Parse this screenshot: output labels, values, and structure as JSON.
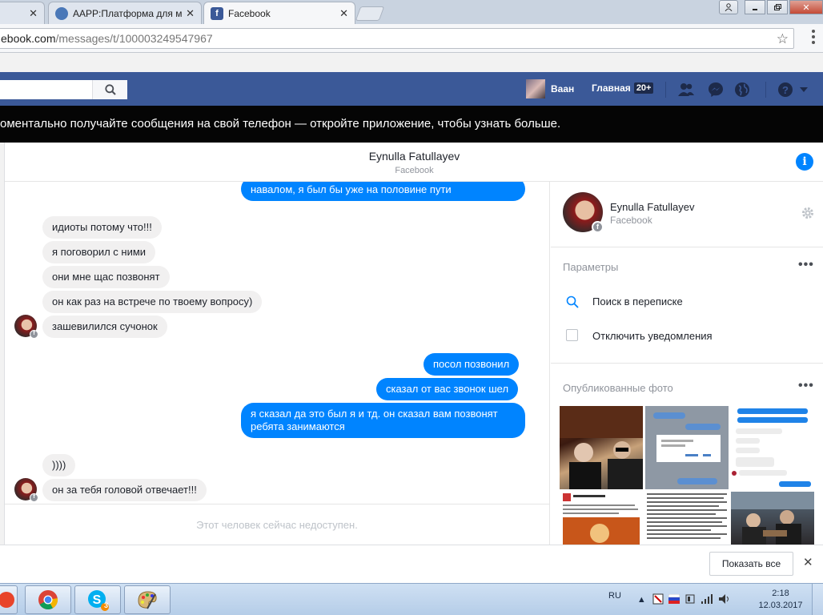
{
  "browser": {
    "tabs": [
      {
        "label": "",
        "close": "✕"
      },
      {
        "label": "AAPP:Платформа для м",
        "close": "✕"
      },
      {
        "label": "Facebook",
        "close": "✕"
      }
    ],
    "url_domain": "ebook.com",
    "url_path": "/messages/t/100003249547967"
  },
  "fb_bar": {
    "user_name": "Ваан",
    "home_label": "Главная",
    "home_badge": "20+"
  },
  "banner": {
    "text": "оментально получайте сообщения на свой телефон — откройте приложение, чтобы узнать больше."
  },
  "conversation": {
    "name": "Eynulla Fatullayev",
    "subtitle": "Facebook",
    "info_label": "i",
    "messages": [
      {
        "dir": "out",
        "text": "навалом, я был бы уже на половине пути"
      },
      {
        "dir": "in",
        "text": "идиоты потому что!!!"
      },
      {
        "dir": "in",
        "text": "я поговорил с ними"
      },
      {
        "dir": "in",
        "text": "они мне щас позвонят"
      },
      {
        "dir": "in",
        "text": "он как раз на встрече по твоему вопросу)"
      },
      {
        "dir": "in",
        "text": "зашевилился сучонок"
      },
      {
        "dir": "out",
        "text": "посол позвонил"
      },
      {
        "dir": "out",
        "text": "сказал от вас звонок шел"
      },
      {
        "dir": "out",
        "text": "я сказал да это был я и тд. он сказал вам позвонят",
        "text2": "ребята занимаются"
      },
      {
        "dir": "in",
        "text": "))))"
      },
      {
        "dir": "in",
        "text": "он за тебя головой отвечает!!!"
      }
    ],
    "unavailable": "Этот человек сейчас недоступен."
  },
  "right_panel": {
    "name": "Eynulla Fatullayev",
    "subtitle": "Facebook",
    "options_title": "Параметры",
    "search_label": "Поиск в переписке",
    "mute_label": "Отключить уведомления",
    "photos_title": "Опубликованные фото",
    "more": "•••"
  },
  "bottom": {
    "show_all": "Показать все",
    "close": "✕"
  },
  "taskbar": {
    "lang": "RU",
    "time": "2:18",
    "date": "12.03.2017",
    "skype_badge": "3"
  },
  "colors": {
    "fb_blue": "#3b5998",
    "messenger_blue": "#0084ff"
  }
}
